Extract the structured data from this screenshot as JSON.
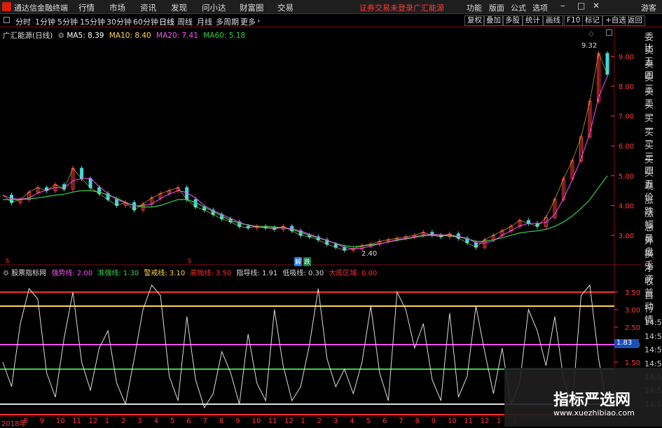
{
  "menubar": {
    "app_title": "通达信金融终端",
    "items": [
      "行情",
      "市场",
      "资讯",
      "发现",
      "问小达",
      "财富圈",
      "交易"
    ],
    "warning": "证券交易未登录",
    "stock_name": "广汇能源",
    "right_items": [
      "功能",
      "版面",
      "公式",
      "选项"
    ],
    "user": "游客"
  },
  "periods": [
    "分时",
    "1分钟",
    "5分钟",
    "15分钟",
    "30分钟",
    "60分钟",
    "日线",
    "周线",
    "月线",
    "多周期",
    "更多"
  ],
  "toolbar": [
    "复权",
    "叠加",
    "多股",
    "统计",
    "画线",
    "F10",
    "标记",
    "+自选",
    "返回"
  ],
  "main_legend": {
    "title": "广汇能源(日线)",
    "ma": [
      {
        "label": "MA5: 8.39",
        "color": "#ffffff"
      },
      {
        "label": "MA10: 8.40",
        "color": "#ffd84a"
      },
      {
        "label": "MA20: 7.41",
        "color": "#ff4fff"
      },
      {
        "label": "MA60: 5.18",
        "color": "#36d04a"
      }
    ]
  },
  "price_axis": [
    "9.00",
    "8.00",
    "7.00",
    "6.00",
    "5.00",
    "4.00",
    "3.00"
  ],
  "annotations": {
    "high": "9.32",
    "low": "2.40",
    "marks": [
      "解",
      "跌"
    ],
    "s_marks": [
      "S",
      "S"
    ]
  },
  "indicator_legend": {
    "title": "股票指标网",
    "items": [
      {
        "label": "强势线: 2.00",
        "color": "#ff4fff"
      },
      {
        "label": "准强线: 1.30",
        "color": "#36d04a"
      },
      {
        "label": "警戒线: 3.10",
        "color": "#ffd84a"
      },
      {
        "label": "高抛线: 3.50",
        "color": "#ff3030"
      },
      {
        "label": "指导线: 1.91",
        "color": "#dddddd"
      },
      {
        "label": "低吸线: 0.30",
        "color": "#dddddd"
      },
      {
        "label": "大底区域: 0.00",
        "color": "#ff3030"
      }
    ]
  },
  "indicator_axis": [
    "3.50",
    "3.00",
    "2.50",
    "2.00",
    "1.50"
  ],
  "indicator_current": "1.83",
  "time_axis": [
    "2018年",
    "8",
    "9",
    "10",
    "11",
    "12",
    "1",
    "2",
    "3",
    "4",
    "5",
    "6",
    "7",
    "8",
    "9",
    "10",
    "11",
    "12",
    "1",
    "2",
    "3",
    "4",
    "5",
    "6",
    "7",
    "8",
    "9",
    "10",
    "11",
    "12",
    "1",
    "2"
  ],
  "right_panel": [
    "委比",
    "卖五",
    "卖四",
    "卖三",
    "卖二",
    "卖一",
    "买一",
    "买二",
    "买三",
    "买四",
    "买五",
    "现价",
    "涨跌",
    "涨幅",
    "总量",
    "外盘",
    "换手",
    "净资",
    "收益",
    "自动",
    "行情",
    "14:50",
    "14:50",
    "14:50",
    "14:50",
    "14:50",
    "14:50",
    "14:50"
  ],
  "watermark": {
    "title": "指标严选网",
    "url": "www.xuezhibiao.com"
  },
  "chart_data": {
    "type": "line",
    "price_range": [
      2.2,
      9.6
    ],
    "indicator_range": [
      0,
      3.9
    ],
    "indicator_levels": [
      {
        "name": "高抛线",
        "value": 3.5,
        "color": "#ff3030"
      },
      {
        "name": "警戒线",
        "value": 3.1,
        "color": "#ffd84a"
      },
      {
        "name": "强势线",
        "value": 2.0,
        "color": "#ff4fff"
      },
      {
        "name": "准强线",
        "value": 1.3,
        "color": "#36d04a"
      },
      {
        "name": "低吸线",
        "value": 0.3,
        "color": "#dddddd"
      },
      {
        "name": "大底区域",
        "value": 0.0,
        "color": "#ff3030"
      }
    ],
    "price_close": [
      4.35,
      4.1,
      4.2,
      4.45,
      4.6,
      4.5,
      4.7,
      4.55,
      5.25,
      4.9,
      4.6,
      4.4,
      4.2,
      4.0,
      4.1,
      3.85,
      4.05,
      4.25,
      4.4,
      4.5,
      4.6,
      4.2,
      3.95,
      3.85,
      3.7,
      3.55,
      3.45,
      3.3,
      3.25,
      3.3,
      3.25,
      3.2,
      3.3,
      3.15,
      3.0,
      2.95,
      2.85,
      2.7,
      2.6,
      2.5,
      2.55,
      2.65,
      2.7,
      2.8,
      2.85,
      2.9,
      2.95,
      3.0,
      3.1,
      3.0,
      2.95,
      3.05,
      2.9,
      2.75,
      2.6,
      2.85,
      3.0,
      3.15,
      3.3,
      3.5,
      3.4,
      3.3,
      3.6,
      4.2,
      4.9,
      5.5,
      6.3,
      7.5,
      9.1,
      8.4
    ],
    "ma_slow": [
      4.2,
      4.2,
      4.2,
      4.22,
      4.25,
      4.3,
      4.35,
      4.38,
      4.45,
      4.5,
      4.5,
      4.45,
      4.35,
      4.25,
      4.1,
      4.0,
      3.95,
      3.95,
      4.0,
      4.1,
      4.2,
      4.2,
      4.1,
      3.95,
      3.8,
      3.65,
      3.5,
      3.4,
      3.35,
      3.3,
      3.3,
      3.28,
      3.25,
      3.2,
      3.1,
      3.0,
      2.92,
      2.82,
      2.73,
      2.65,
      2.62,
      2.64,
      2.68,
      2.72,
      2.78,
      2.83,
      2.88,
      2.93,
      2.98,
      3.0,
      3.0,
      2.98,
      2.95,
      2.88,
      2.8,
      2.8,
      2.85,
      2.92,
      3.0,
      3.08,
      3.12,
      3.15,
      3.2,
      3.3,
      3.45,
      3.65,
      3.9,
      4.2,
      4.6,
      5.0
    ],
    "indicator": [
      1.5,
      0.8,
      2.6,
      3.6,
      3.3,
      1.2,
      0.5,
      2.2,
      3.5,
      1.5,
      0.7,
      1.9,
      2.4,
      0.9,
      0.3,
      1.6,
      3.0,
      3.7,
      3.4,
      1.1,
      0.4,
      2.8,
      1.0,
      0.2,
      0.6,
      1.8,
      1.2,
      0.3,
      2.3,
      0.9,
      0.4,
      3.0,
      1.4,
      0.4,
      0.8,
      2.0,
      3.6,
      1.6,
      0.8,
      1.3,
      0.6,
      1.5,
      3.1,
      1.2,
      0.4,
      3.5,
      3.0,
      1.9,
      2.6,
      1.0,
      0.4,
      2.9,
      0.5,
      1.1,
      3.1,
      1.8,
      0.6,
      1.9,
      0.3,
      0.9,
      3.0,
      2.4,
      1.4,
      2.8,
      1.0,
      0.3,
      3.4,
      3.7,
      1.6,
      0.2
    ]
  }
}
